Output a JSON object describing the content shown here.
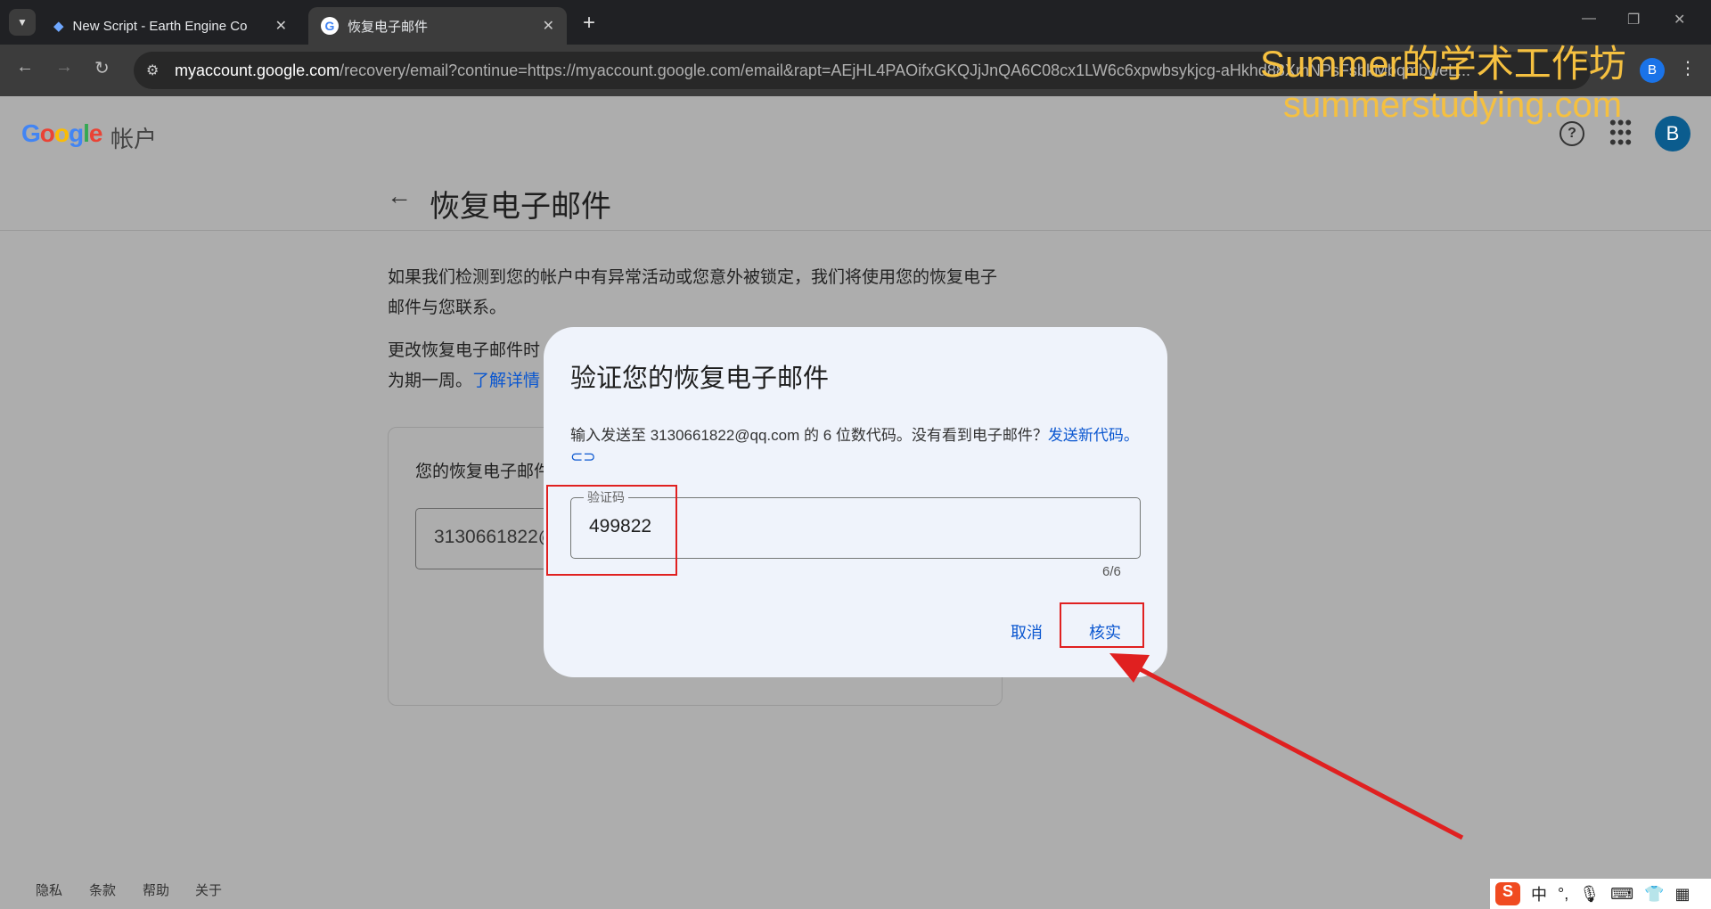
{
  "browser": {
    "tabs": [
      {
        "title": "New Script - Earth Engine Co",
        "icon": "earth-engine-icon"
      },
      {
        "title": "恢复电子邮件",
        "icon": "google-g-icon"
      }
    ],
    "url_host": "myaccount.google.com",
    "url_path": "/recovery/email?continue=https://myaccount.google.com/email&rapt=AEjHL4PAOifxGKQJjJnQA6C08cx1LW6c6xpwbsykjcg-aHkhd88XmNPsFsbkMbqmbweL...",
    "profile_initial": "B"
  },
  "header": {
    "logo": "Google",
    "product": "帐户",
    "avatar_initial": "B"
  },
  "page": {
    "title": "恢复电子邮件",
    "para1": "如果我们检测到您的帐户中有异常活动或您意外被锁定，我们将使用您的恢复电子邮件与您联系。",
    "para2": "更改恢复电子邮件时",
    "para2b": "为期一周。",
    "para2_link": "了解详情",
    "card_label": "您的恢复电子邮件",
    "card_value": "3130661822@qq.com"
  },
  "dialog": {
    "title": "验证您的恢复电子邮件",
    "desc": "输入发送至 3130661822@qq.com 的 6 位数代码。没有看到电子邮件？",
    "resend_link": "发送新代码。",
    "field_label": "验证码",
    "field_value": "499822",
    "counter": "6/6",
    "cancel": "取消",
    "verify": "核实"
  },
  "footer": [
    "隐私",
    "条款",
    "帮助",
    "关于"
  ],
  "watermark": {
    "line1": "Summer的学术工作坊",
    "line2": "summerstudying.com"
  },
  "annotation_color": "#e02020",
  "ime": [
    "中",
    "°,"
  ]
}
